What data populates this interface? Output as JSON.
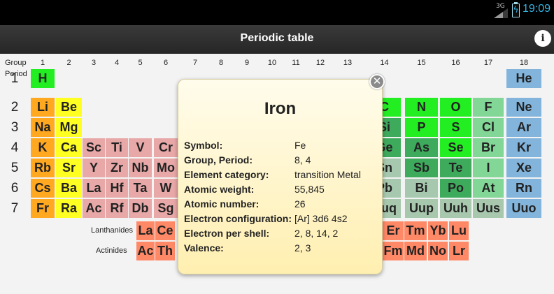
{
  "status_bar": {
    "network": "3G",
    "time": "19:09",
    "signal_icon": "signal-icon",
    "battery_icon": "battery-charging-icon"
  },
  "action_bar": {
    "title": "Periodic table",
    "info_icon": "info-icon",
    "info_label": "i"
  },
  "table": {
    "group_label": "Group",
    "period_label": "Period",
    "groups": [
      "1",
      "2",
      "3",
      "4",
      "5",
      "6",
      "7",
      "8",
      "9",
      "10",
      "11",
      "12",
      "13",
      "14",
      "15",
      "16",
      "17",
      "18"
    ],
    "periods": [
      "1",
      "2",
      "3",
      "4",
      "5",
      "6",
      "7"
    ],
    "lanthanides_label": "Lanthanides",
    "actinides_label": "Actinides",
    "elements": [
      {
        "symbol": "H",
        "row": 1,
        "col": 1,
        "category": "nonmetal"
      },
      {
        "symbol": "He",
        "row": 1,
        "col": 18,
        "category": "noble"
      },
      {
        "symbol": "Li",
        "row": 2,
        "col": 1,
        "category": "alkali"
      },
      {
        "symbol": "Be",
        "row": 2,
        "col": 2,
        "category": "alkaline"
      },
      {
        "symbol": "C",
        "row": 2,
        "col": 14,
        "category": "nonmetal"
      },
      {
        "symbol": "N",
        "row": 2,
        "col": 15,
        "category": "nonmetal"
      },
      {
        "symbol": "O",
        "row": 2,
        "col": 16,
        "category": "nonmetal"
      },
      {
        "symbol": "F",
        "row": 2,
        "col": 17,
        "category": "halogen"
      },
      {
        "symbol": "Ne",
        "row": 2,
        "col": 18,
        "category": "noble"
      },
      {
        "symbol": "Na",
        "row": 3,
        "col": 1,
        "category": "alkali"
      },
      {
        "symbol": "Mg",
        "row": 3,
        "col": 2,
        "category": "alkaline"
      },
      {
        "symbol": "Si",
        "row": 3,
        "col": 14,
        "category": "metalloid"
      },
      {
        "symbol": "P",
        "row": 3,
        "col": 15,
        "category": "nonmetal"
      },
      {
        "symbol": "S",
        "row": 3,
        "col": 16,
        "category": "nonmetal"
      },
      {
        "symbol": "Cl",
        "row": 3,
        "col": 17,
        "category": "halogen"
      },
      {
        "symbol": "Ar",
        "row": 3,
        "col": 18,
        "category": "noble"
      },
      {
        "symbol": "K",
        "row": 4,
        "col": 1,
        "category": "alkali"
      },
      {
        "symbol": "Ca",
        "row": 4,
        "col": 2,
        "category": "alkaline"
      },
      {
        "symbol": "Sc",
        "row": 4,
        "col": 3,
        "category": "trans"
      },
      {
        "symbol": "Ti",
        "row": 4,
        "col": 4,
        "category": "trans"
      },
      {
        "symbol": "V",
        "row": 4,
        "col": 5,
        "category": "trans"
      },
      {
        "symbol": "Cr",
        "row": 4,
        "col": 6,
        "category": "trans"
      },
      {
        "symbol": "Ge",
        "row": 4,
        "col": 14,
        "category": "metalloid"
      },
      {
        "symbol": "As",
        "row": 4,
        "col": 15,
        "category": "metalloid"
      },
      {
        "symbol": "Se",
        "row": 4,
        "col": 16,
        "category": "nonmetal"
      },
      {
        "symbol": "Br",
        "row": 4,
        "col": 17,
        "category": "halogen"
      },
      {
        "symbol": "Kr",
        "row": 4,
        "col": 18,
        "category": "noble"
      },
      {
        "symbol": "Rb",
        "row": 5,
        "col": 1,
        "category": "alkali"
      },
      {
        "symbol": "Sr",
        "row": 5,
        "col": 2,
        "category": "alkaline"
      },
      {
        "symbol": "Y",
        "row": 5,
        "col": 3,
        "category": "trans"
      },
      {
        "symbol": "Zr",
        "row": 5,
        "col": 4,
        "category": "trans"
      },
      {
        "symbol": "Nb",
        "row": 5,
        "col": 5,
        "category": "trans"
      },
      {
        "symbol": "Mo",
        "row": 5,
        "col": 6,
        "category": "trans"
      },
      {
        "symbol": "Sn",
        "row": 5,
        "col": 14,
        "category": "poor"
      },
      {
        "symbol": "Sb",
        "row": 5,
        "col": 15,
        "category": "metalloid"
      },
      {
        "symbol": "Te",
        "row": 5,
        "col": 16,
        "category": "metalloid"
      },
      {
        "symbol": "I",
        "row": 5,
        "col": 17,
        "category": "halogen"
      },
      {
        "symbol": "Xe",
        "row": 5,
        "col": 18,
        "category": "noble"
      },
      {
        "symbol": "Cs",
        "row": 6,
        "col": 1,
        "category": "alkali"
      },
      {
        "symbol": "Ba",
        "row": 6,
        "col": 2,
        "category": "alkaline"
      },
      {
        "symbol": "La",
        "row": 6,
        "col": 3,
        "category": "trans"
      },
      {
        "symbol": "Hf",
        "row": 6,
        "col": 4,
        "category": "trans"
      },
      {
        "symbol": "Ta",
        "row": 6,
        "col": 5,
        "category": "trans"
      },
      {
        "symbol": "W",
        "row": 6,
        "col": 6,
        "category": "trans"
      },
      {
        "symbol": "Pb",
        "row": 6,
        "col": 14,
        "category": "poor"
      },
      {
        "symbol": "Bi",
        "row": 6,
        "col": 15,
        "category": "poor"
      },
      {
        "symbol": "Po",
        "row": 6,
        "col": 16,
        "category": "metalloid"
      },
      {
        "symbol": "At",
        "row": 6,
        "col": 17,
        "category": "halogen"
      },
      {
        "symbol": "Rn",
        "row": 6,
        "col": 18,
        "category": "noble"
      },
      {
        "symbol": "Fr",
        "row": 7,
        "col": 1,
        "category": "alkali"
      },
      {
        "symbol": "Ra",
        "row": 7,
        "col": 2,
        "category": "alkaline"
      },
      {
        "symbol": "Ac",
        "row": 7,
        "col": 3,
        "category": "trans"
      },
      {
        "symbol": "Rf",
        "row": 7,
        "col": 4,
        "category": "trans"
      },
      {
        "symbol": "Db",
        "row": 7,
        "col": 5,
        "category": "trans"
      },
      {
        "symbol": "Sg",
        "row": 7,
        "col": 6,
        "category": "trans"
      },
      {
        "symbol": "Uuq",
        "row": 7,
        "col": 14,
        "category": "unknown"
      },
      {
        "symbol": "Uup",
        "row": 7,
        "col": 15,
        "category": "unknown"
      },
      {
        "symbol": "Uuh",
        "row": 7,
        "col": 16,
        "category": "unknown"
      },
      {
        "symbol": "Uus",
        "row": 7,
        "col": 17,
        "category": "unknown"
      },
      {
        "symbol": "Uuo",
        "row": 7,
        "col": 18,
        "category": "noble"
      }
    ],
    "lanthanides": [
      "La",
      "Ce",
      "Er",
      "Tm",
      "Yb",
      "Lu"
    ],
    "actinides": [
      "Ac",
      "Th",
      "Fm",
      "Md",
      "No",
      "Lr"
    ]
  },
  "popup": {
    "name": "Iron",
    "close_icon": "close-icon",
    "close_label": "✕",
    "rows": [
      {
        "key": "Symbol:",
        "value": "Fe"
      },
      {
        "key": "Group, Period:",
        "value": "8, 4"
      },
      {
        "key": "Element category:",
        "value": "transition Metal"
      },
      {
        "key": "Atomic weight:",
        "value": "55,845"
      },
      {
        "key": "Atomic number:",
        "value": "26"
      },
      {
        "key": "Electron configuration:",
        "value": "[Ar] 3d6 4s2"
      },
      {
        "key": "Electron per shell:",
        "value": "2, 8, 14, 2"
      },
      {
        "key": "Valence:",
        "value": "2, 3"
      }
    ]
  },
  "colors": {
    "alkali": "#ffa820",
    "alkaline": "#ffff22",
    "trans": "#e8a8a8",
    "nonmetal": "#22ee22",
    "metalloid": "#3eaa5c",
    "halogen": "#82d696",
    "noble": "#82b4dc",
    "poor": "#a6c8ae",
    "lanthanide_row": "#ff8866",
    "accent": "#33b5e5"
  }
}
